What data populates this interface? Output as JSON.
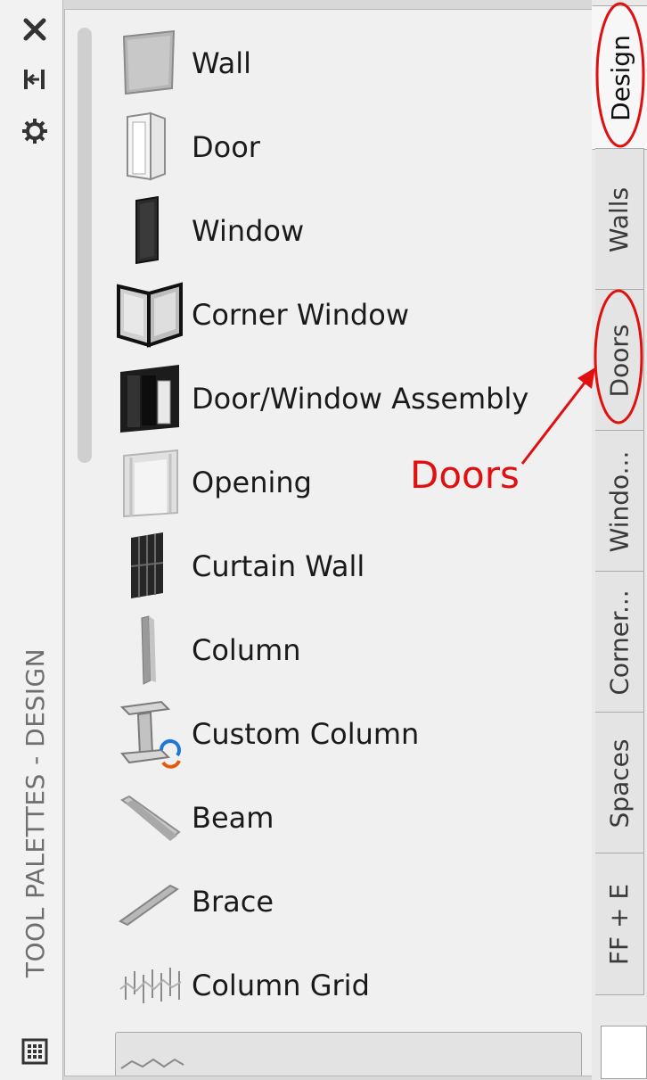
{
  "palette": {
    "title": "TOOL PALETTES - DESIGN"
  },
  "tools": [
    {
      "label": "Wall",
      "icon": "wall-icon"
    },
    {
      "label": "Door",
      "icon": "door-icon"
    },
    {
      "label": "Window",
      "icon": "window-icon"
    },
    {
      "label": "Corner Window",
      "icon": "corner-window-icon"
    },
    {
      "label": "Door/Window Assembly",
      "icon": "door-window-assembly-icon"
    },
    {
      "label": "Opening",
      "icon": "opening-icon"
    },
    {
      "label": "Curtain Wall",
      "icon": "curtain-wall-icon"
    },
    {
      "label": "Column",
      "icon": "column-icon"
    },
    {
      "label": "Custom Column",
      "icon": "custom-column-icon"
    },
    {
      "label": "Beam",
      "icon": "beam-icon"
    },
    {
      "label": "Brace",
      "icon": "brace-icon"
    },
    {
      "label": "Column Grid",
      "icon": "column-grid-icon"
    }
  ],
  "tabs": [
    "Design",
    "Walls",
    "Doors",
    "Windo...",
    "Corner...",
    "Spaces",
    "FF + E"
  ],
  "active_tab": "Design",
  "annotation": {
    "label": "Doors",
    "color": "#e01010"
  }
}
